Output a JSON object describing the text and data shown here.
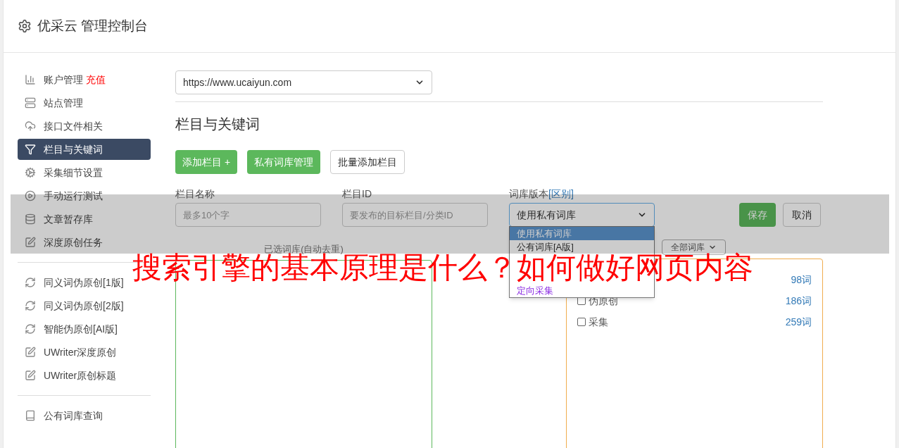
{
  "header": {
    "title": "优采云 管理控制台"
  },
  "sidebar": {
    "groups": [
      [
        {
          "kind": "chart",
          "label": "账户管理",
          "badge": "充值",
          "selected": false
        },
        {
          "kind": "server",
          "label": "站点管理",
          "selected": false
        },
        {
          "kind": "cloud",
          "label": "接口文件相关",
          "selected": false
        },
        {
          "kind": "filter",
          "label": "栏目与关键词",
          "selected": true
        },
        {
          "kind": "cogs",
          "label": "采集细节设置",
          "selected": false
        },
        {
          "kind": "play",
          "label": "手动运行测试",
          "selected": false
        },
        {
          "kind": "database",
          "label": "文章暂存库",
          "selected": false
        },
        {
          "kind": "edit",
          "label": "深度原创任务",
          "selected": false
        }
      ],
      [
        {
          "kind": "refresh",
          "label": "同义词伪原创[1版]",
          "selected": false
        },
        {
          "kind": "refresh",
          "label": "同义词伪原创[2版]",
          "selected": false
        },
        {
          "kind": "refresh",
          "label": "智能伪原创[AI版]",
          "selected": false
        },
        {
          "kind": "edit",
          "label": "UWriter深度原创",
          "selected": false
        },
        {
          "kind": "edit",
          "label": "UWriter原创标题",
          "selected": false
        }
      ],
      [
        {
          "kind": "book",
          "label": "公有词库查询",
          "selected": false
        }
      ]
    ]
  },
  "site_select": {
    "value": "https://www.ucaiyun.com"
  },
  "section_title": "栏目与关键词",
  "toolbar": [
    {
      "label": "添加栏目 +",
      "kind": "primary"
    },
    {
      "label": "私有词库管理",
      "kind": "primary"
    },
    {
      "label": "批量添加栏目",
      "kind": "default"
    }
  ],
  "form": {
    "name": {
      "label": "栏目名称",
      "placeholder": "最多10个字"
    },
    "id": {
      "label": "栏目ID",
      "placeholder": "要发布的目标栏目/分类ID"
    },
    "version": {
      "label": "词库版本",
      "link": "[区别]",
      "value": "使用私有词库",
      "options": [
        {
          "label": "使用私有词库",
          "selected": true
        },
        {
          "label": "公有词库[A版]",
          "selected": false
        },
        {
          "label": "定向采集",
          "selected": false,
          "color": "#8a2be2"
        }
      ]
    },
    "save": "保存",
    "cancel": "取消"
  },
  "selected_libraries": {
    "title": "已选词库(自动去重)"
  },
  "library_filter": {
    "value": "全部词库"
  },
  "libraries": [
    {
      "count": "98词"
    },
    {
      "label": "伪原创",
      "count": "186词",
      "checked": false
    },
    {
      "label": "采集",
      "count": "259词",
      "checked": false
    }
  ],
  "overlay": {
    "headline": "搜索引擎的基本原理是什么？如何做好网页内容"
  }
}
